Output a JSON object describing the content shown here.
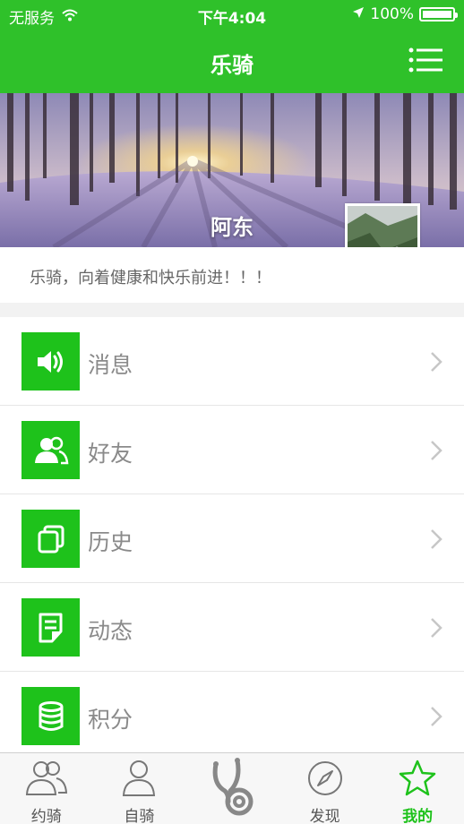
{
  "status": {
    "carrier": "无服务",
    "time": "下午4:04",
    "battery": "100%"
  },
  "header": {
    "title": "乐骑"
  },
  "profile": {
    "name": "阿东",
    "signature": "乐骑，向着健康和快乐前进！！！"
  },
  "menu": [
    {
      "label": "消息",
      "icon": "speaker-icon"
    },
    {
      "label": "好友",
      "icon": "friends-icon"
    },
    {
      "label": "历史",
      "icon": "history-icon"
    },
    {
      "label": "动态",
      "icon": "note-icon"
    },
    {
      "label": "积分",
      "icon": "database-icon"
    }
  ],
  "tabs": [
    {
      "label": "约骑",
      "icon": "group-icon"
    },
    {
      "label": "自骑",
      "icon": "person-icon"
    },
    {
      "label": "",
      "icon": "logo-icon"
    },
    {
      "label": "发现",
      "icon": "compass-icon"
    },
    {
      "label": "我的",
      "icon": "star-icon",
      "active": true
    }
  ],
  "colors": {
    "brand_green": "#2fc12a",
    "tile_green": "#1ec21b",
    "active_tab": "#1ec21b"
  }
}
